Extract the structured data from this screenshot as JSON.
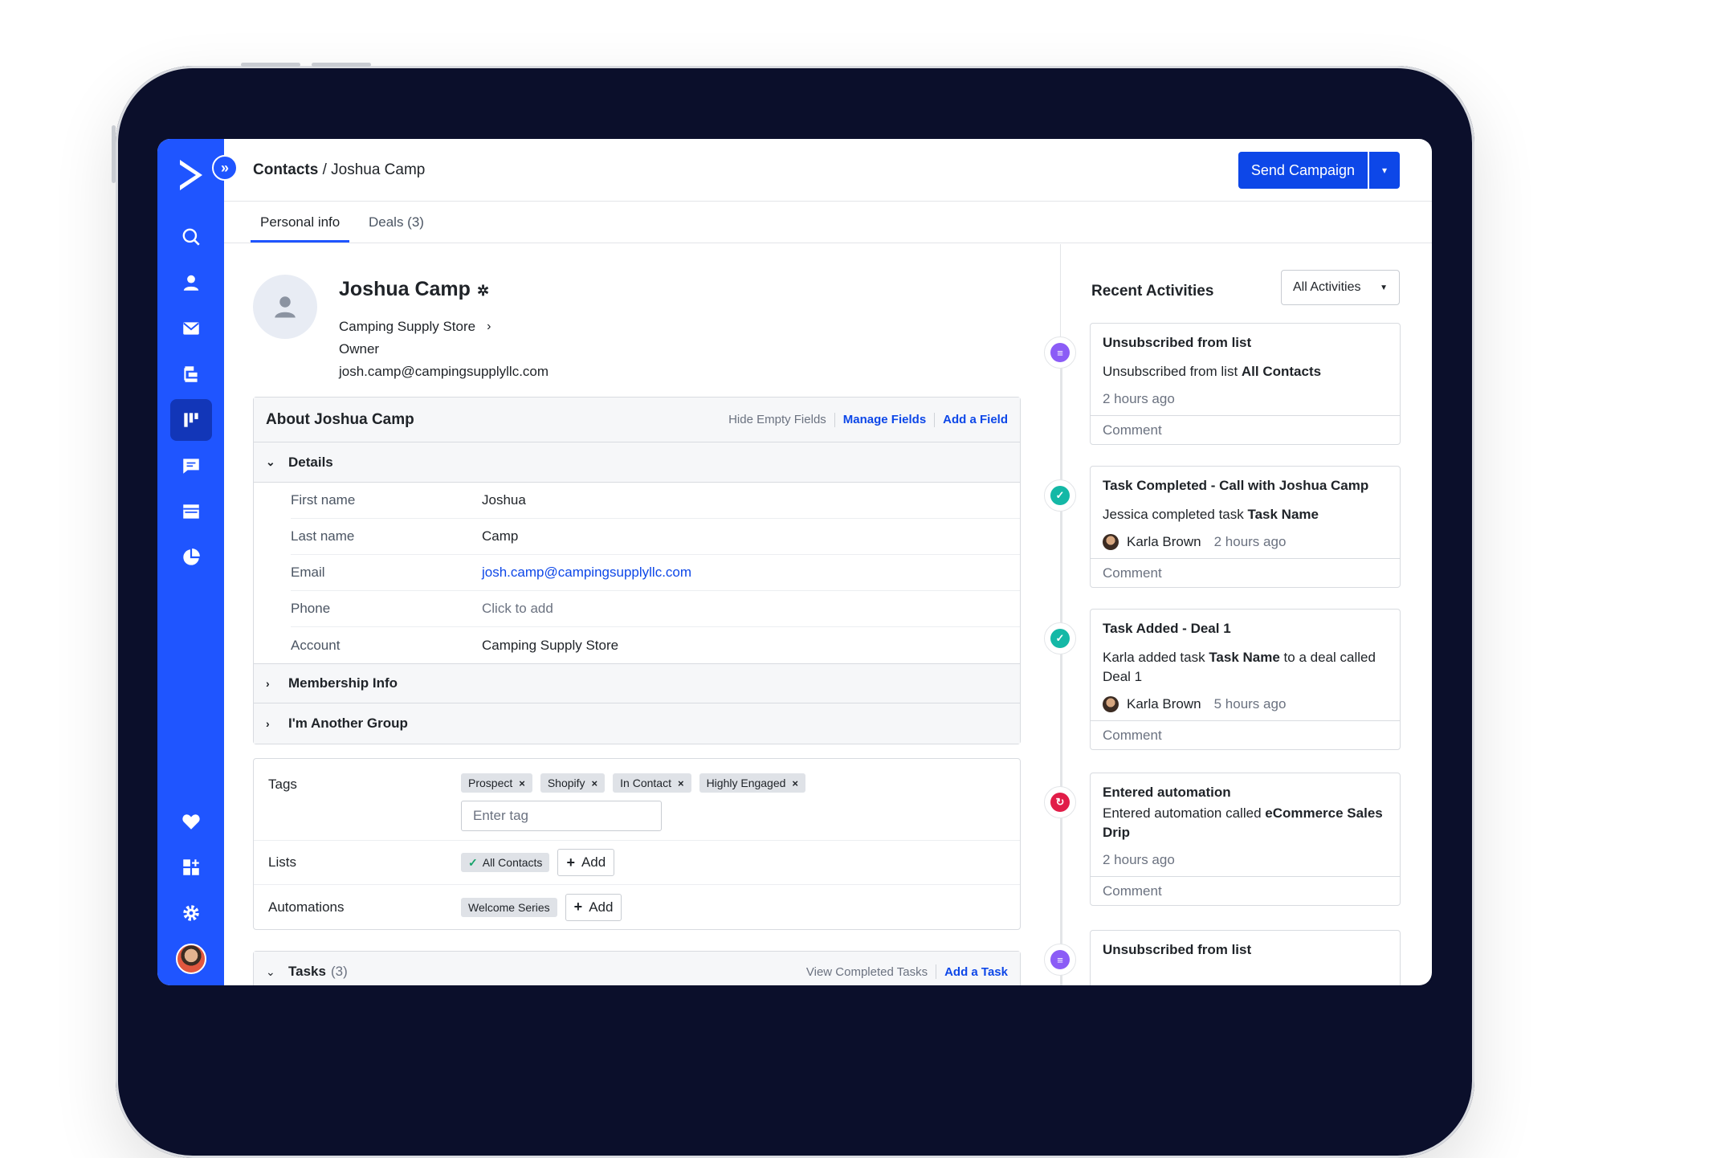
{
  "breadcrumb": {
    "root": "Contacts",
    "sep": " / ",
    "current": "Joshua Camp"
  },
  "header": {
    "send_label": "Send Campaign",
    "send_caret": "▾"
  },
  "tabs": [
    {
      "label": "Personal info"
    },
    {
      "label": "Deals (3)"
    }
  ],
  "profile": {
    "name": "Joshua Camp",
    "company": "Camping Supply Store",
    "role": "Owner",
    "email": "josh.camp@campingsupplyllc.com"
  },
  "about": {
    "title": "About Joshua Camp",
    "hide_empty": "Hide Empty Fields",
    "manage_fields": "Manage Fields",
    "add_field": "Add a Field",
    "details_label": "Details",
    "fields": [
      {
        "key": "First name",
        "value": "Joshua"
      },
      {
        "key": "Last name",
        "value": "Camp"
      },
      {
        "key": "Email",
        "value": "josh.camp@campingsupplyllc.com"
      },
      {
        "key": "Phone",
        "value": "Click to add"
      },
      {
        "key": "Account",
        "value": "Camping Supply Store"
      }
    ],
    "membership_label": "Membership Info",
    "another_group_label": "I'm Another Group"
  },
  "tags": {
    "label": "Tags",
    "items": [
      "Prospect",
      "Shopify",
      "In Contact",
      "Highly Engaged"
    ],
    "remove_glyph": "×",
    "placeholder": "Enter tag",
    "lists_label": "Lists",
    "list_items": [
      "All Contacts"
    ],
    "add_label": "Add",
    "automations_label": "Automations",
    "automation_items": [
      "Welcome Series"
    ]
  },
  "tasks": {
    "label": "Tasks",
    "count": "(3)",
    "view_completed": "View Completed Tasks",
    "add_task": "Add a Task"
  },
  "activities": {
    "title": "Recent Activities",
    "filter": "All Activities",
    "comment_label": "Comment",
    "items": [
      {
        "title": "Unsubscribed from list",
        "pre": "Unsubscribed from list ",
        "bold": "All Contacts",
        "post": "",
        "time": "2 hours ago",
        "who": ""
      },
      {
        "title": "Task Completed - Call with Joshua Camp",
        "pre": "Jessica completed task ",
        "bold": "Task Name",
        "post": "",
        "time": "2 hours ago",
        "who": "Karla Brown"
      },
      {
        "title": "Task Added - Deal 1",
        "pre": "Karla added task ",
        "bold": "Task Name",
        "post": " to a deal called Deal 1",
        "time": "5 hours ago",
        "who": "Karla Brown"
      },
      {
        "title": "Entered automation",
        "pre": "Entered automation called ",
        "bold": "eCommerce Sales Drip",
        "post": "",
        "time": "2 hours ago",
        "who": ""
      },
      {
        "title": "Unsubscribed from list"
      }
    ]
  },
  "colors": {
    "brand": "#1f55ff",
    "primary_button": "#0d47e8",
    "list_icon": "#8b5cf6",
    "task_icon": "#14b8a6",
    "automation_icon": "#e11d48"
  }
}
